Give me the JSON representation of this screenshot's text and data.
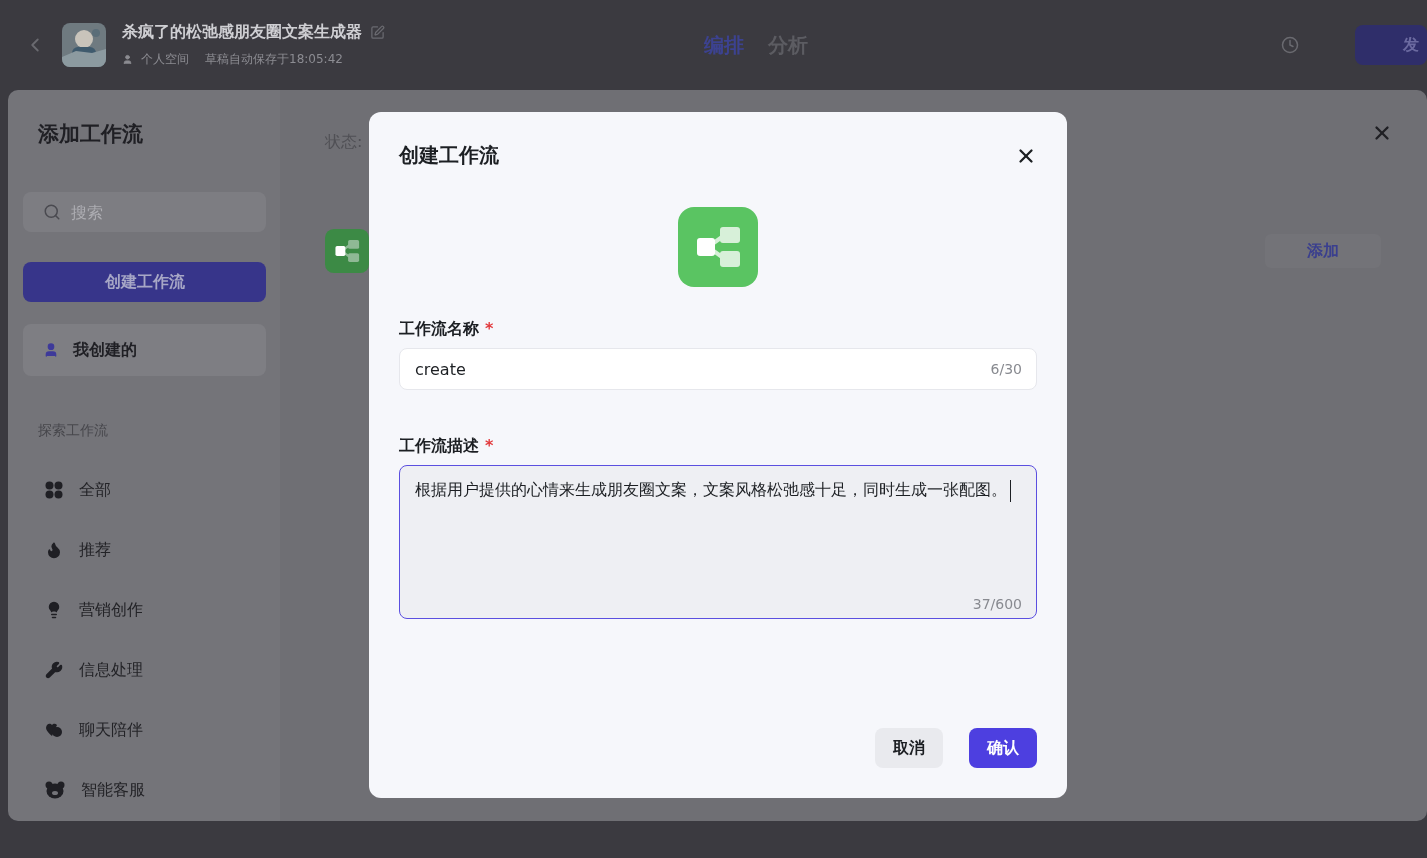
{
  "header": {
    "title": "杀疯了的松弛感朋友圈文案生成器",
    "space": "个人空间",
    "autosave": "草稿自动保存于18:05:42",
    "tabs": [
      {
        "label": "编排",
        "selected": true
      },
      {
        "label": "分析",
        "selected": false
      }
    ],
    "publish": "发"
  },
  "drawer": {
    "title": "添加工作流",
    "search": {
      "placeholder": "搜索"
    },
    "create_button": "创建工作流",
    "mine": {
      "label": "我创建的",
      "selected": true
    },
    "section": "探索工作流",
    "categories": [
      {
        "label": "全部",
        "kind": "grid",
        "selected": false
      },
      {
        "label": "推荐",
        "kind": "flame",
        "selected": false
      },
      {
        "label": "营销创作",
        "kind": "bulb",
        "selected": false
      },
      {
        "label": "信息处理",
        "kind": "wrench",
        "selected": false
      },
      {
        "label": "聊天陪伴",
        "kind": "hearts",
        "selected": false
      },
      {
        "label": "智能客服",
        "kind": "bear",
        "selected": false
      }
    ],
    "status_label": "状态:",
    "add_button": "添加"
  },
  "modal": {
    "title": "创建工作流",
    "fields": [
      {
        "label": "工作流名称",
        "required_mark": "*",
        "kind": "input",
        "value": "create",
        "counter": "6/30",
        "focused": false
      },
      {
        "label": "工作流描述",
        "required_mark": "*",
        "kind": "textarea",
        "value": "根据用户提供的心情来生成朋友圈文案，文案风格松弛感十足，同时生成一张配图。",
        "counter": "37/600",
        "focused": true
      }
    ],
    "buttons": [
      {
        "label": "取消",
        "kind": "secondary"
      },
      {
        "label": "确认",
        "kind": "primary"
      }
    ]
  }
}
